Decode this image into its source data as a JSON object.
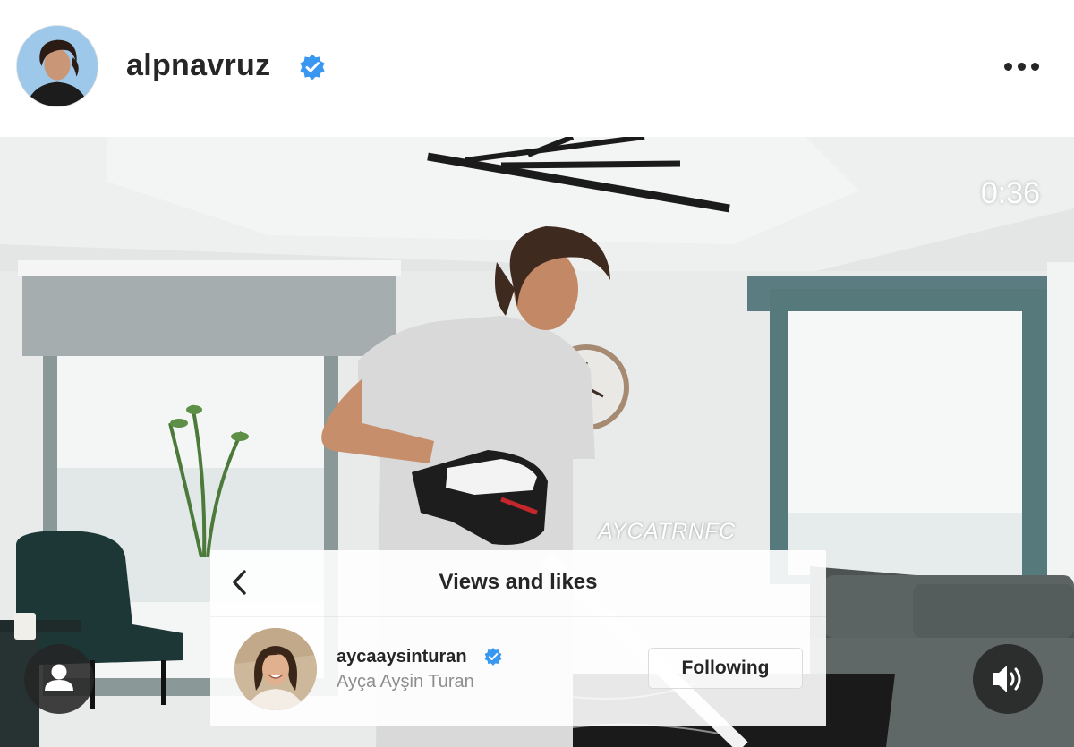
{
  "post": {
    "username": "alpnavruz",
    "verified": true,
    "more_icon": "more-horizontal-icon"
  },
  "video": {
    "timer": "0:36",
    "watermark": "AYCATRNFC"
  },
  "likes_panel": {
    "title": "Views and likes",
    "back_icon": "chevron-left-icon",
    "user": {
      "username": "aycaaysinturan",
      "full_name": "Ayça Ayşin Turan",
      "verified": true,
      "follow_label": "Following"
    }
  },
  "controls": {
    "tags_icon": "user-tag-icon",
    "sound_icon": "speaker-on-icon"
  },
  "colors": {
    "verified_blue": "#3897f0",
    "text_primary": "#262626",
    "text_secondary": "#8e8e8e"
  }
}
